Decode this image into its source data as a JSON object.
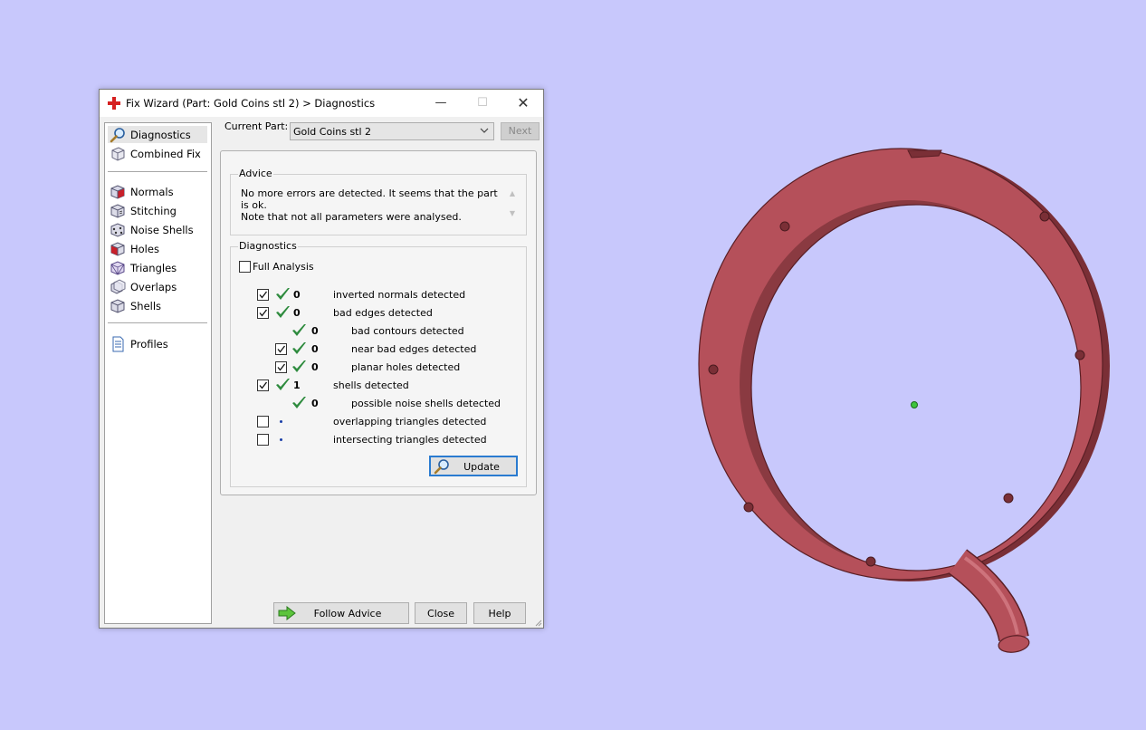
{
  "window": {
    "title": "Fix Wizard (Part: Gold Coins stl 2) > Diagnostics",
    "title_icon": "red-cross-icon",
    "controls": {
      "minimize": "—",
      "maximize": "☐",
      "close": "✕"
    }
  },
  "sidebar": {
    "top_items": [
      {
        "label": "Diagnostics",
        "icon": "magnifier-icon",
        "selected": true
      },
      {
        "label": "Combined Fix",
        "icon": "cube-icon",
        "selected": false
      }
    ],
    "fix_items": [
      {
        "label": "Normals",
        "icon": "normals-cube-icon"
      },
      {
        "label": "Stitching",
        "icon": "stitching-cube-icon"
      },
      {
        "label": "Noise Shells",
        "icon": "noise-shells-icon"
      },
      {
        "label": "Holes",
        "icon": "holes-cube-icon"
      },
      {
        "label": "Triangles",
        "icon": "triangles-cube-icon"
      },
      {
        "label": "Overlaps",
        "icon": "overlaps-cube-icon"
      },
      {
        "label": "Shells",
        "icon": "shells-cube-icon"
      }
    ],
    "bottom_items": [
      {
        "label": "Profiles",
        "icon": "document-icon"
      }
    ]
  },
  "current_part": {
    "label": "Current Part:",
    "value": "Gold Coins stl 2",
    "next_button": "Next"
  },
  "advice": {
    "title": "Advice",
    "lines": [
      "No more errors are detected. It seems that the part is ok.",
      "Note that not all parameters were analysed."
    ]
  },
  "diagnostics": {
    "title": "Diagnostics",
    "full_analysis_label": "Full Analysis",
    "full_analysis_checked": false,
    "rows": [
      {
        "checkbox": true,
        "checked": true,
        "status": "ok",
        "count": "0",
        "label": "inverted normals detected",
        "indent": 0
      },
      {
        "checkbox": true,
        "checked": true,
        "status": "ok",
        "count": "0",
        "label": "bad edges detected",
        "indent": 0
      },
      {
        "checkbox": false,
        "checked": false,
        "status": "ok",
        "count": "0",
        "label": "bad contours detected",
        "indent": 1
      },
      {
        "checkbox": true,
        "checked": true,
        "status": "ok",
        "count": "0",
        "label": "near bad edges detected",
        "indent": 1
      },
      {
        "checkbox": true,
        "checked": true,
        "status": "ok",
        "count": "0",
        "label": "planar holes detected",
        "indent": 1
      },
      {
        "checkbox": true,
        "checked": true,
        "status": "ok",
        "count": "1",
        "label": "shells detected",
        "indent": 0
      },
      {
        "checkbox": false,
        "checked": false,
        "status": "ok",
        "count": "0",
        "label": "possible noise shells detected",
        "indent": 1
      },
      {
        "checkbox": true,
        "checked": false,
        "status": "not-analysed",
        "count": "",
        "label": "overlapping triangles detected",
        "indent": 0
      },
      {
        "checkbox": true,
        "checked": false,
        "status": "not-analysed",
        "count": "",
        "label": "intersecting triangles detected",
        "indent": 0
      }
    ],
    "update_button": "Update"
  },
  "buttons": {
    "follow_advice": "Follow Advice",
    "close": "Close",
    "help": "Help"
  },
  "colors": {
    "viewport_background": "#c8c8fc",
    "model_ring": "#b5505a",
    "model_ring_dark": "#7a2f36",
    "check_green": "#2e8b3e",
    "focus_blue": "#2a7bd0"
  },
  "viewport": {
    "model_icon": "red-ring-with-pipe-model",
    "center_marker": "green-dot-icon"
  }
}
